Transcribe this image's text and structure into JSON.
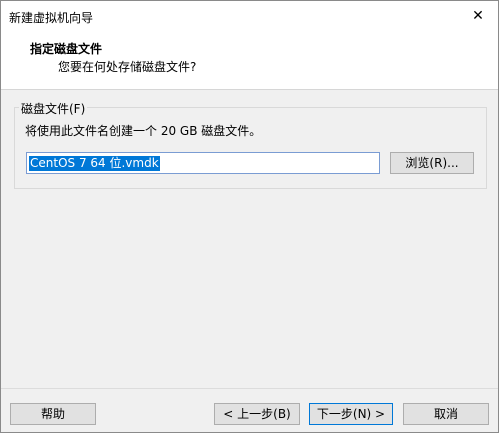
{
  "window": {
    "title": "新建虚拟机向导",
    "close_glyph": "✕"
  },
  "header": {
    "title": "指定磁盘文件",
    "subtitle": "您要在何处存储磁盘文件?"
  },
  "disk_file_group": {
    "legend": "磁盘文件(F)",
    "description": "将使用此文件名创建一个 20 GB 磁盘文件。",
    "file_name_value": "CentOS 7 64 位.vmdk",
    "browse_label": "浏览(R)..."
  },
  "footer": {
    "help_label": "帮助",
    "back_label": "< 上一步(B)",
    "next_label": "下一步(N) >",
    "cancel_label": "取消"
  }
}
